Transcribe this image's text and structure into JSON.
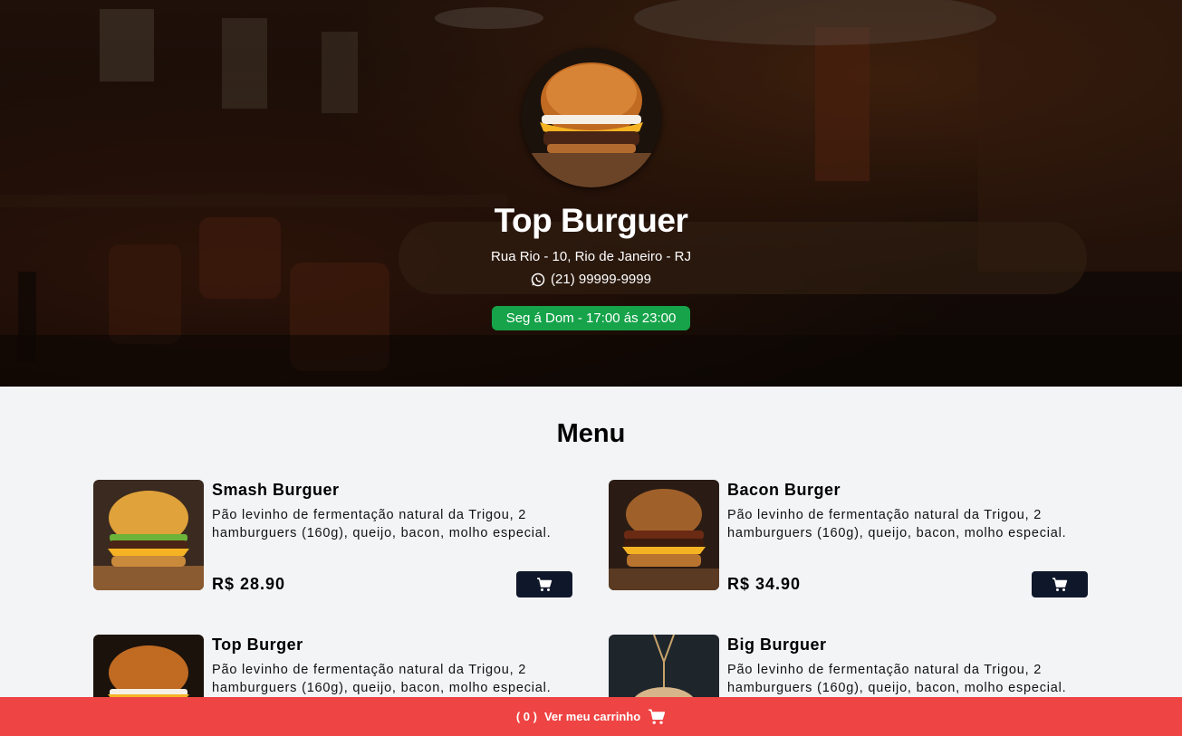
{
  "restaurant": {
    "name": "Top Burguer",
    "address": "Rua Rio - 10, Rio de Janeiro - RJ",
    "phone": "(21) 99999-9999",
    "hours": "Seg á Dom - 17:00 ás 23:00"
  },
  "menu": {
    "title": "Menu",
    "currency": "R$",
    "items": [
      {
        "name": "Smash Burguer",
        "description": "Pão levinho de fermentação natural da Trigou, 2 hamburguers (160g), queijo, bacon, molho especial.",
        "price": "R$ 28.90"
      },
      {
        "name": "Bacon Burger",
        "description": "Pão levinho de fermentação natural da Trigou, 2 hamburguers (160g), queijo, bacon, molho especial.",
        "price": "R$ 34.90"
      },
      {
        "name": "Top Burger",
        "description": "Pão levinho de fermentação natural da Trigou, 2 hamburguers (160g), queijo, bacon, molho especial.",
        "price": ""
      },
      {
        "name": "Big Burguer",
        "description": "Pão levinho de fermentação natural da Trigou, 2 hamburguers (160g), queijo, bacon, molho especial.",
        "price": ""
      }
    ]
  },
  "cart_bar": {
    "count_text": "( 0 )",
    "label": "Ver meu carrinho"
  },
  "colors": {
    "hours_badge": "#16a34a",
    "cart_button": "#0f172a",
    "cart_bar": "#ef4444",
    "page_background": "#f3f4f6"
  },
  "icons": [
    "whatsapp-icon",
    "cart-icon"
  ]
}
